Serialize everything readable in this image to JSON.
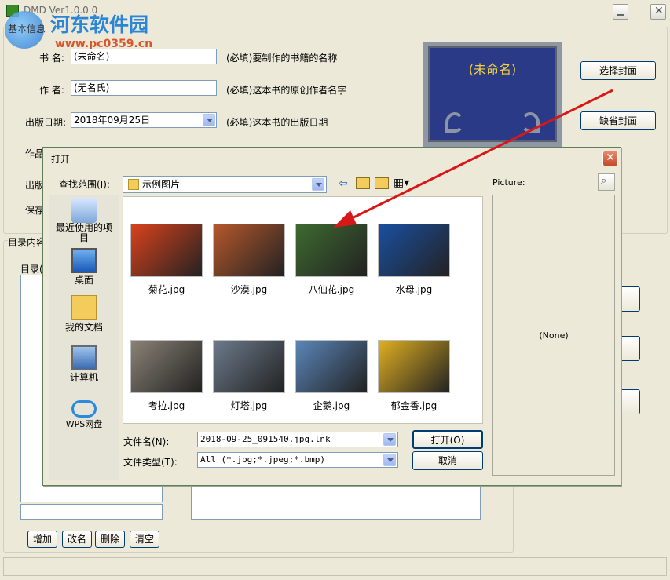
{
  "window": {
    "title": "DMD Ver1.0.0.0",
    "tab_basic": "基本信息",
    "watermark_name": "河东软件园",
    "watermark_url": "www.pc0359.cn"
  },
  "form": {
    "book_name_label": "书  名:",
    "book_name_value": "(未命名)",
    "book_name_hint": "(必填)要制作的书籍的名称",
    "author_label": "作  者:",
    "author_value": "(无名氏)",
    "author_hint": "(必填)这本书的原创作者名字",
    "pubdate_label": "出版日期:",
    "pubdate_value": "2018年09月25日",
    "pubdate_hint": "(必填)这本书的出版日期",
    "works_label": "作品",
    "publisher_label": "出版",
    "save_label": "保存"
  },
  "cover": {
    "title": "(未命名)",
    "choose_button": "选择封面",
    "default_button": "缺省封面"
  },
  "toc": {
    "group_label": "目录内容",
    "list_label": "目录(",
    "add_button": "增加",
    "rename_button": "改名",
    "delete_button": "删除",
    "clear_button": "清空"
  },
  "dialog": {
    "title": "打开",
    "look_in_label": "查找范围(I):",
    "look_in_value": "示例图片",
    "places": [
      {
        "label": "最近使用的项目",
        "icon": "recent-items-icon"
      },
      {
        "label": "桌面",
        "icon": "desktop-icon"
      },
      {
        "label": "我的文档",
        "icon": "my-documents-icon"
      },
      {
        "label": "计算机",
        "icon": "computer-icon"
      },
      {
        "label": "WPS网盘",
        "icon": "wps-cloud-icon"
      }
    ],
    "files": [
      {
        "name": "菊花.jpg",
        "color": "#d8421c"
      },
      {
        "name": "沙漠.jpg",
        "color": "#b5582c"
      },
      {
        "name": "八仙花.jpg",
        "color": "#3e6a30"
      },
      {
        "name": "水母.jpg",
        "color": "#1a4fa0"
      },
      {
        "name": "考拉.jpg",
        "color": "#8a8276"
      },
      {
        "name": "灯塔.jpg",
        "color": "#6c7a8c"
      },
      {
        "name": "企鹅.jpg",
        "color": "#5a86b8"
      },
      {
        "name": "郁金香.jpg",
        "color": "#e0b020"
      }
    ],
    "filename_label": "文件名(N):",
    "filename_value": "2018-09-25_091540.jpg.lnk",
    "filetype_label": "文件类型(T):",
    "filetype_value": "All (*.jpg;*.jpeg;*.bmp)",
    "open_button": "打开(O)",
    "cancel_button": "取消",
    "preview_label": "Picture:",
    "preview_value": "(None)"
  }
}
